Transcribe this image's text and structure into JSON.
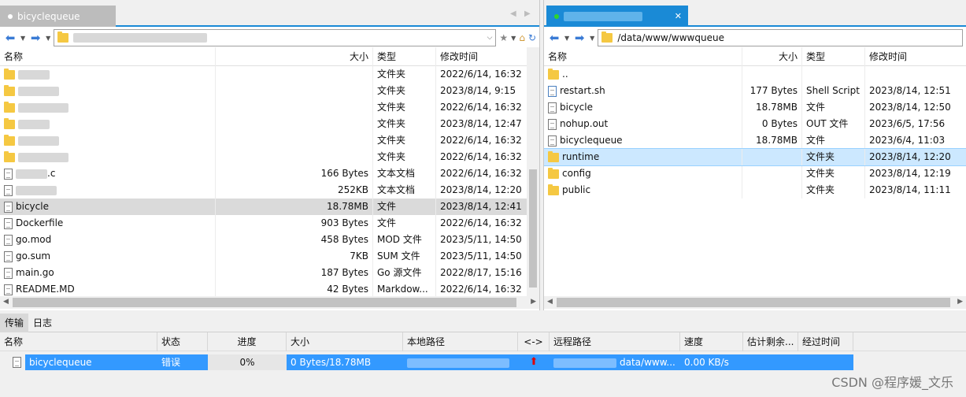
{
  "left": {
    "tab_title": "bicyclequeue",
    "columns": {
      "name": "名称",
      "size": "大小",
      "type": "类型",
      "modified": "修改时间"
    },
    "rows": [
      {
        "name": "",
        "size": "",
        "type": "文件夹",
        "modified": "2022/6/14, 16:32",
        "icon": "folder-icon",
        "redacted": true
      },
      {
        "name": "",
        "size": "",
        "type": "文件夹",
        "modified": "2023/8/14, 9:15",
        "icon": "folder-icon",
        "redacted": true
      },
      {
        "name": "",
        "size": "",
        "type": "文件夹",
        "modified": "2022/6/14, 16:32",
        "icon": "folder-icon",
        "redacted": true
      },
      {
        "name": "",
        "size": "",
        "type": "文件夹",
        "modified": "2023/8/14, 12:47",
        "icon": "folder-icon",
        "redacted": true
      },
      {
        "name": "",
        "size": "",
        "type": "文件夹",
        "modified": "2022/6/14, 16:32",
        "icon": "folder-icon",
        "redacted": true
      },
      {
        "name": "",
        "size": "",
        "type": "文件夹",
        "modified": "2022/6/14, 16:32",
        "icon": "folder-icon",
        "redacted": true
      },
      {
        "name": ".c",
        "size": "166 Bytes",
        "type": "文本文档",
        "modified": "2022/6/14, 16:32",
        "icon": "document-icon",
        "redacted": true
      },
      {
        "name": "",
        "size": "252KB",
        "type": "文本文档",
        "modified": "2023/8/14, 12:20",
        "icon": "document-icon",
        "redacted": true
      },
      {
        "name": "bicycle",
        "size": "18.78MB",
        "type": "文件",
        "modified": "2023/8/14, 12:41",
        "icon": "document-icon",
        "redacted": false
      },
      {
        "name": "Dockerfile",
        "size": "903 Bytes",
        "type": "文件",
        "modified": "2022/6/14, 16:32",
        "icon": "document-icon",
        "redacted": false
      },
      {
        "name": "go.mod",
        "size": "458 Bytes",
        "type": "MOD 文件",
        "modified": "2023/5/11, 14:50",
        "icon": "document-icon",
        "redacted": false
      },
      {
        "name": "go.sum",
        "size": "7KB",
        "type": "SUM 文件",
        "modified": "2023/5/11, 14:50",
        "icon": "document-icon",
        "redacted": false
      },
      {
        "name": "main.go",
        "size": "187 Bytes",
        "type": "Go 源文件",
        "modified": "2022/8/17, 15:16",
        "icon": "document-icon",
        "redacted": false
      },
      {
        "name": "README.MD",
        "size": "42 Bytes",
        "type": "Markdow...",
        "modified": "2022/6/14, 16:32",
        "icon": "document-icon",
        "redacted": false
      }
    ]
  },
  "right": {
    "path": "/data/www/wwwqueue",
    "columns": {
      "name": "名称",
      "size": "大小",
      "type": "类型",
      "modified": "修改时间"
    },
    "rows": [
      {
        "name": "..",
        "size": "",
        "type": "",
        "modified": "",
        "icon": "folder-icon"
      },
      {
        "name": "restart.sh",
        "size": "177 Bytes",
        "type": "Shell Script",
        "modified": "2023/8/14, 12:51",
        "icon": "script-icon"
      },
      {
        "name": "bicycle",
        "size": "18.78MB",
        "type": "文件",
        "modified": "2023/8/14, 12:50",
        "icon": "document-icon"
      },
      {
        "name": "nohup.out",
        "size": "0 Bytes",
        "type": "OUT 文件",
        "modified": "2023/6/5, 17:56",
        "icon": "document-icon"
      },
      {
        "name": "bicyclequeue",
        "size": "18.78MB",
        "type": "文件",
        "modified": "2023/6/4, 11:03",
        "icon": "document-icon"
      },
      {
        "name": "runtime",
        "size": "",
        "type": "文件夹",
        "modified": "2023/8/14, 12:20",
        "icon": "folder-icon"
      },
      {
        "name": "config",
        "size": "",
        "type": "文件夹",
        "modified": "2023/8/14, 12:19",
        "icon": "folder-icon"
      },
      {
        "name": "public",
        "size": "",
        "type": "文件夹",
        "modified": "2023/8/14, 11:11",
        "icon": "folder-icon"
      }
    ]
  },
  "transfer": {
    "tabs": [
      "传输",
      "日志"
    ],
    "columns": {
      "name": "名称",
      "status": "状态",
      "progress": "进度",
      "size": "大小",
      "local": "本地路径",
      "dir": "<->",
      "remote": "远程路径",
      "speed": "速度",
      "eta": "估计剩余...",
      "elapsed": "经过时间"
    },
    "row": {
      "name": "bicyclequeue",
      "status": "错误",
      "progress": "0%",
      "size": "0 Bytes/18.78MB",
      "remote": "data/www...",
      "speed": "0.00 KB/s"
    }
  },
  "watermark": "CSDN @程序媛_文乐",
  "colors": {
    "accent": "#1a8ad6",
    "selection": "#3399ff",
    "upload_arrow": "#e00000"
  }
}
